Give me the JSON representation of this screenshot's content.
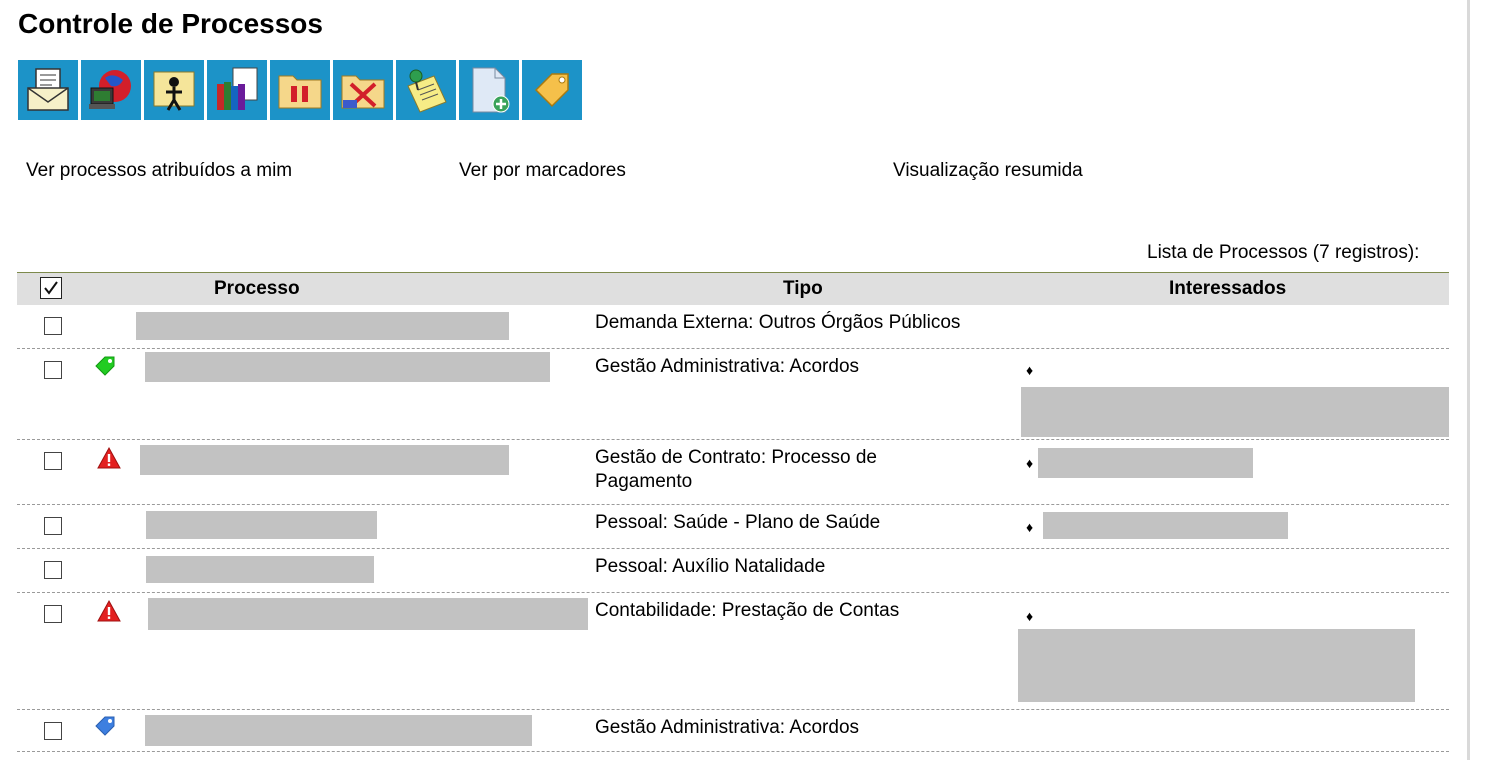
{
  "page": {
    "title": "Controle de Processos"
  },
  "toolbar": {
    "buttons": [
      {
        "icon": "envelope-document-icon"
      },
      {
        "icon": "computer-globe-icon"
      },
      {
        "icon": "person-folder-icon"
      },
      {
        "icon": "books-document-icon"
      },
      {
        "icon": "pause-folder-icon"
      },
      {
        "icon": "cancel-folder-icon"
      },
      {
        "icon": "pinned-note-icon"
      },
      {
        "icon": "new-document-icon"
      },
      {
        "icon": "tag-icon"
      }
    ]
  },
  "links": {
    "assigned": "Ver processos atribuídos a mim",
    "markers": "Ver por marcadores",
    "summary": "Visualização resumida"
  },
  "table": {
    "caption": "Lista de Processos (7 registros):",
    "headers": {
      "processo": "Processo",
      "tipo": "Tipo",
      "interessados": "Interessados"
    },
    "rows": [
      {
        "tipo": "Demanda Externa: Outros Órgãos Públicos",
        "marker": "none",
        "has_interessados": false
      },
      {
        "tipo": "Gestão Administrativa: Acordos",
        "marker": "green-tag-icon",
        "has_interessados": true,
        "interessado_bullet": "♦"
      },
      {
        "tipo": "Gestão de Contrato: Processo de Pagamento",
        "marker": "red-warning-icon",
        "has_interessados": true,
        "interessado_bullet": "♦"
      },
      {
        "tipo": "Pessoal: Saúde - Plano de Saúde",
        "marker": "none",
        "has_interessados": true,
        "interessado_bullet": "♦"
      },
      {
        "tipo": "Pessoal: Auxílio Natalidade",
        "marker": "none",
        "has_interessados": false
      },
      {
        "tipo": "Contabilidade: Prestação de Contas",
        "marker": "red-warning-icon",
        "has_interessados": true,
        "interessado_bullet": "♦"
      },
      {
        "tipo": "Gestão Administrativa: Acordos",
        "marker": "blue-tag-icon",
        "has_interessados": false
      }
    ]
  },
  "colors": {
    "toolbar_bg": "#1c93c8",
    "header_bg": "#dfdfdf",
    "redaction": "#c2c2c2",
    "green_tag": "#22cc22",
    "red_warning": "#e32020",
    "blue_tag": "#3d7fe0"
  }
}
